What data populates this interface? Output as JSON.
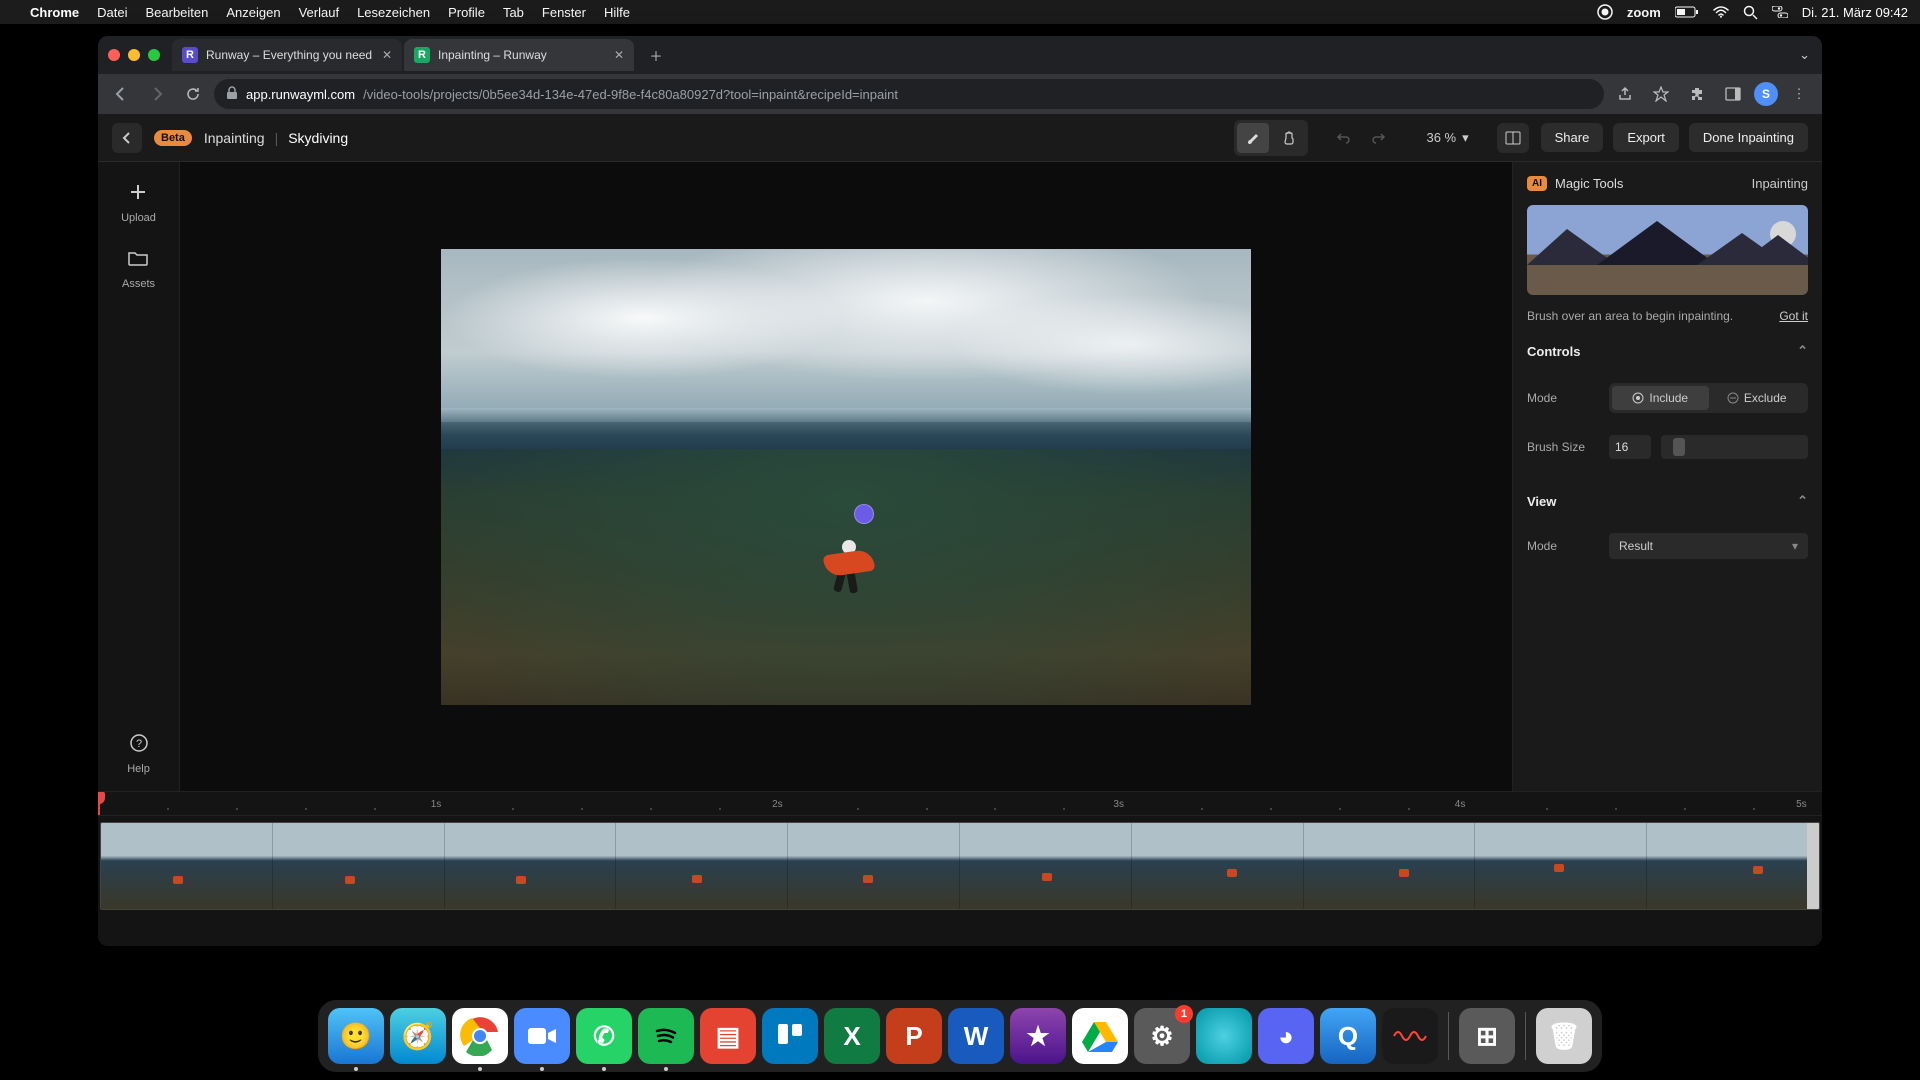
{
  "menubar": {
    "app": "Chrome",
    "items": [
      "Datei",
      "Bearbeiten",
      "Anzeigen",
      "Verlauf",
      "Lesezeichen",
      "Profile",
      "Tab",
      "Fenster",
      "Hilfe"
    ],
    "right": {
      "zoom": "zoom",
      "datetime": "Di. 21. März  09:42"
    }
  },
  "browser": {
    "tabs": [
      {
        "title": "Runway – Everything you need",
        "active": false
      },
      {
        "title": "Inpainting – Runway",
        "active": true
      }
    ],
    "url_host": "app.runwayml.com",
    "url_path": "/video-tools/projects/0b5ee34d-134e-47ed-9f8e-f4c80a80927d?tool=inpaint&recipeId=inpaint",
    "profile_initial": "S"
  },
  "topbar": {
    "beta": "Beta",
    "section": "Inpainting",
    "project": "Skydiving",
    "zoom": "36 %",
    "actions": {
      "share": "Share",
      "export": "Export",
      "done": "Done Inpainting"
    }
  },
  "leftbar": {
    "upload": "Upload",
    "assets": "Assets",
    "help": "Help"
  },
  "rightpanel": {
    "magic_tools": "Magic Tools",
    "mode_label": "Inpainting",
    "hint": "Brush over an area to begin inpainting.",
    "gotit": "Got it",
    "controls_header": "Controls",
    "mode_row_label": "Mode",
    "include": "Include",
    "exclude": "Exclude",
    "brush_label": "Brush Size",
    "brush_value": "16",
    "view_header": "View",
    "view_mode_label": "Mode",
    "view_mode_value": "Result"
  },
  "timeline": {
    "marks": [
      "1s",
      "2s",
      "3s",
      "4s",
      "5s"
    ]
  },
  "dock": {
    "apps": [
      "finder",
      "safari",
      "chrome",
      "zoom",
      "whatsapp",
      "spotify",
      "todoist",
      "trello",
      "excel",
      "powerpoint",
      "word",
      "imovie",
      "drive",
      "settings",
      "circle",
      "discord",
      "quicktime",
      "voice"
    ],
    "settings_badge": "1"
  }
}
